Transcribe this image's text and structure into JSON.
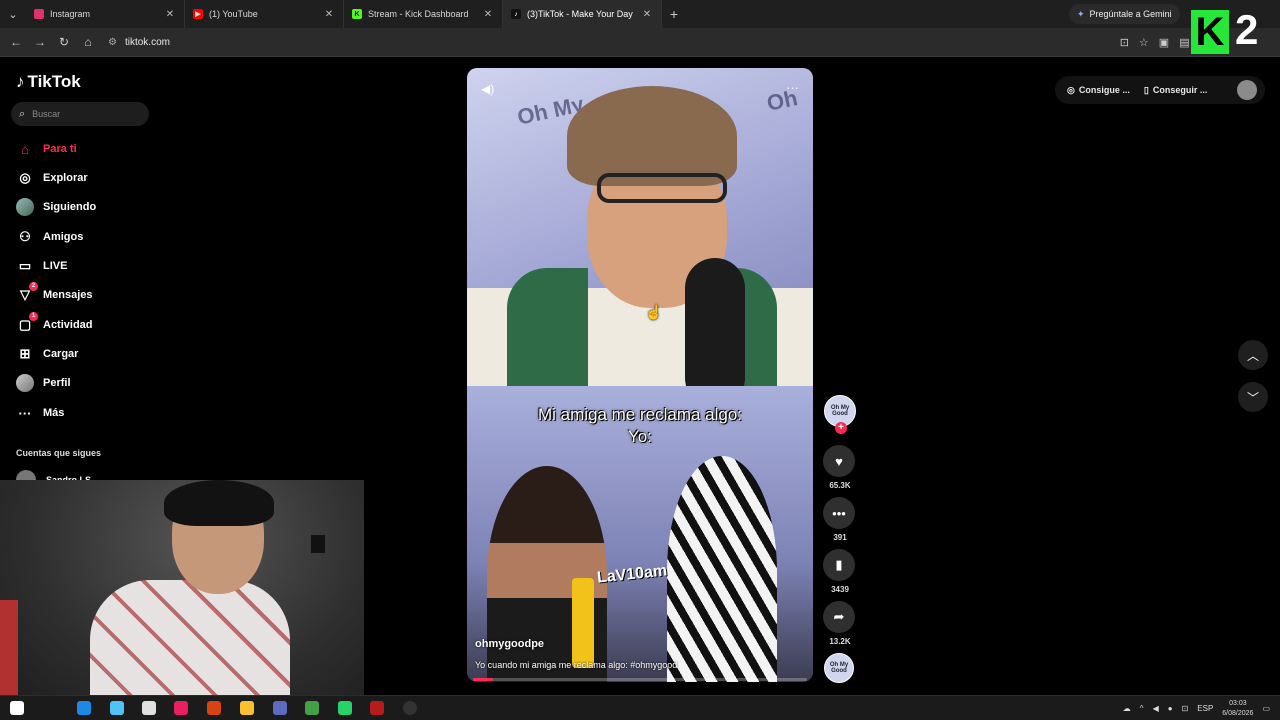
{
  "browser": {
    "tabs": [
      {
        "title": "Instagram",
        "icon": "instagram-icon",
        "color": "#e1306c",
        "active": false
      },
      {
        "title": "(1) YouTube",
        "icon": "youtube-icon",
        "color": "#ff0000",
        "active": false
      },
      {
        "title": "Stream - Kick Dashboard",
        "icon": "kick-icon",
        "color": "#53fc18",
        "active": false
      },
      {
        "title": "(3)TikTok - Make Your Day",
        "icon": "tiktok-icon",
        "color": "#000000",
        "active": true
      }
    ],
    "url": "tiktok.com",
    "gemini_label": "Pregúntale a Gemini"
  },
  "overlay": {
    "k_letter": "K",
    "number": "2"
  },
  "sidebar": {
    "logo": "TikTok",
    "search_placeholder": "Buscar",
    "items": [
      {
        "label": "Para ti",
        "icon": "home-icon",
        "active": true
      },
      {
        "label": "Explorar",
        "icon": "compass-icon"
      },
      {
        "label": "Siguiendo",
        "icon": "avatar-icon"
      },
      {
        "label": "Amigos",
        "icon": "friends-icon"
      },
      {
        "label": "LIVE",
        "icon": "live-icon"
      },
      {
        "label": "Mensajes",
        "icon": "messages-icon",
        "badge": "2"
      },
      {
        "label": "Actividad",
        "icon": "activity-icon",
        "badge": "1"
      },
      {
        "label": "Cargar",
        "icon": "upload-icon"
      },
      {
        "label": "Perfil",
        "icon": "profile-icon"
      },
      {
        "label": "Más",
        "icon": "more-icon"
      }
    ],
    "following_title": "Cuentas que sigues",
    "following": [
      {
        "name": "Sandro LS"
      }
    ]
  },
  "video": {
    "caption_line1": "Mi amiga me reclama algo:",
    "caption_line2": "Yo:",
    "author": "ohmygoodpe",
    "description": "Yo cuando mi amiga me reclama algo: #ohmygood",
    "progress": 0.06,
    "brand_text": "LaV10am"
  },
  "actions": {
    "likes": "65.3K",
    "comments": "391",
    "saves": "3439",
    "shares": "13.2K",
    "avatar_text": "Oh My Good"
  },
  "topbar": {
    "coins_label": "Consigue ...",
    "app_label": "Conseguir ..."
  },
  "taskbar": {
    "language": "ESP",
    "time": "03:03",
    "date": "6/08/2026"
  },
  "colors": {
    "accent": "#fe2c55",
    "kick_green": "#26e63a"
  }
}
